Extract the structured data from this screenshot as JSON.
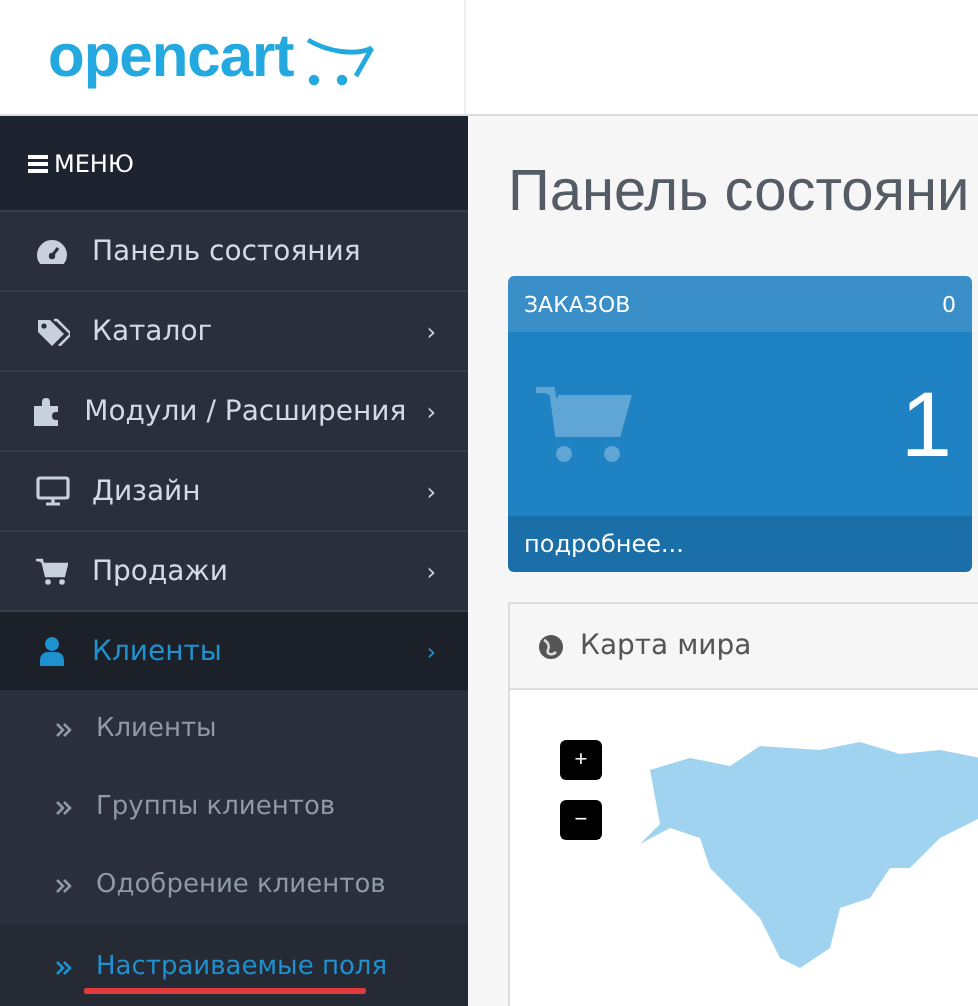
{
  "header": {
    "logo": "opencart"
  },
  "menu": {
    "title": "МЕНЮ",
    "items": [
      {
        "label": "Панель состояния",
        "selected": false
      },
      {
        "label": "Каталог",
        "chevron": "›",
        "selected": false
      },
      {
        "label": "Модули / Расширения",
        "chevron": "›",
        "selected": false
      },
      {
        "label": "Дизайн",
        "chevron": "›",
        "selected": false
      },
      {
        "label": "Продажи",
        "chevron": "›",
        "selected": false
      },
      {
        "label": "Клиенты",
        "chevron": "›",
        "selected": true,
        "children": [
          {
            "label": "Клиенты",
            "selected": false
          },
          {
            "label": "Группы клиентов",
            "selected": false
          },
          {
            "label": "Одобрение клиентов",
            "selected": false
          },
          {
            "label": "Настраиваемые поля",
            "selected": true
          }
        ]
      }
    ]
  },
  "page_title": "Панель состояни",
  "orders_tile": {
    "title": "ЗАКАЗОВ",
    "percent": "0",
    "value": "1",
    "link": "подробнее..."
  },
  "map_panel": {
    "title": "Карта мира",
    "zoom_in": "+",
    "zoom_out": "−"
  }
}
